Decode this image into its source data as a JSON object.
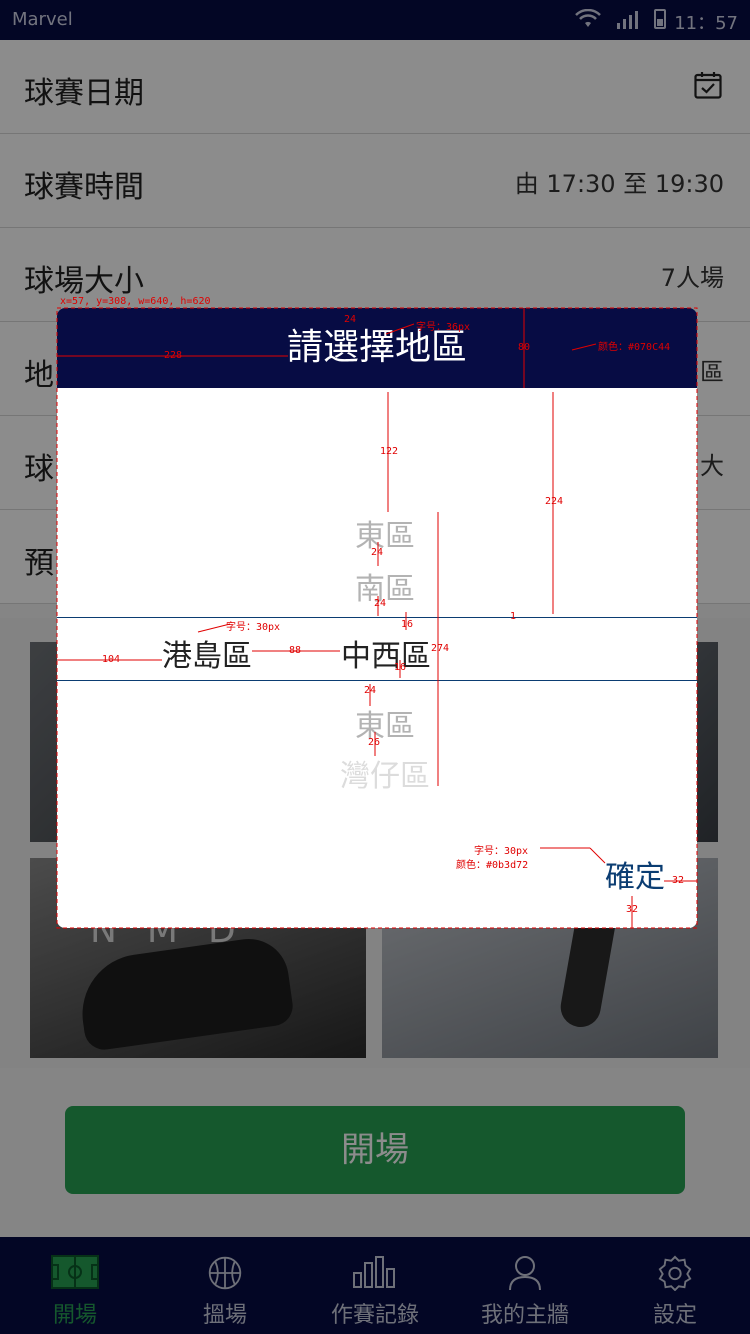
{
  "status_bar": {
    "carrier": "Marvel",
    "time": "11：57"
  },
  "form": {
    "rows": [
      {
        "label": "球賽日期",
        "value": ""
      },
      {
        "label": "球賽時間",
        "value": "由 17:30   至 19:30"
      },
      {
        "label": "球場大小",
        "value": "7人場"
      },
      {
        "label": "地",
        "value": "區"
      },
      {
        "label": "球",
        "value": "大"
      },
      {
        "label": "預",
        "value": ""
      }
    ]
  },
  "banners": {
    "nmd_text": "NMD"
  },
  "open_button": {
    "label": "開場"
  },
  "tabs": [
    {
      "label": "開場",
      "icon": "field-icon",
      "active": true
    },
    {
      "label": "搵場",
      "icon": "basketball-icon",
      "active": false
    },
    {
      "label": "作賽記錄",
      "icon": "bar-chart-icon",
      "active": false
    },
    {
      "label": "我的主牆",
      "icon": "user-icon",
      "active": false
    },
    {
      "label": "設定",
      "icon": "settings-icon",
      "active": false
    }
  ],
  "modal": {
    "title": "請選擇地區",
    "picker_left": "港島區",
    "picker_items": [
      "東區",
      "南區",
      "中西區",
      "東區",
      "灣仔區"
    ],
    "selected_item": "中西區",
    "confirm_label": "確定"
  },
  "colors": {
    "header": "#070C44",
    "confirm": "#0b3d72",
    "accent": "#27a153"
  },
  "annotations": {
    "frame": "x=57, y=308, w=640, h=620",
    "title_font": "字号：36px",
    "header_color": "颜色：#070C44",
    "item_font": "字号：30px",
    "confirm_font": "字号：30px",
    "confirm_color": "颜色：#0b3d72",
    "dims": [
      "24",
      "228",
      "80",
      "122",
      "224",
      "24",
      "24",
      "16",
      "1",
      "104",
      "88",
      "274",
      "16",
      "24",
      "26",
      "32",
      "32"
    ]
  }
}
